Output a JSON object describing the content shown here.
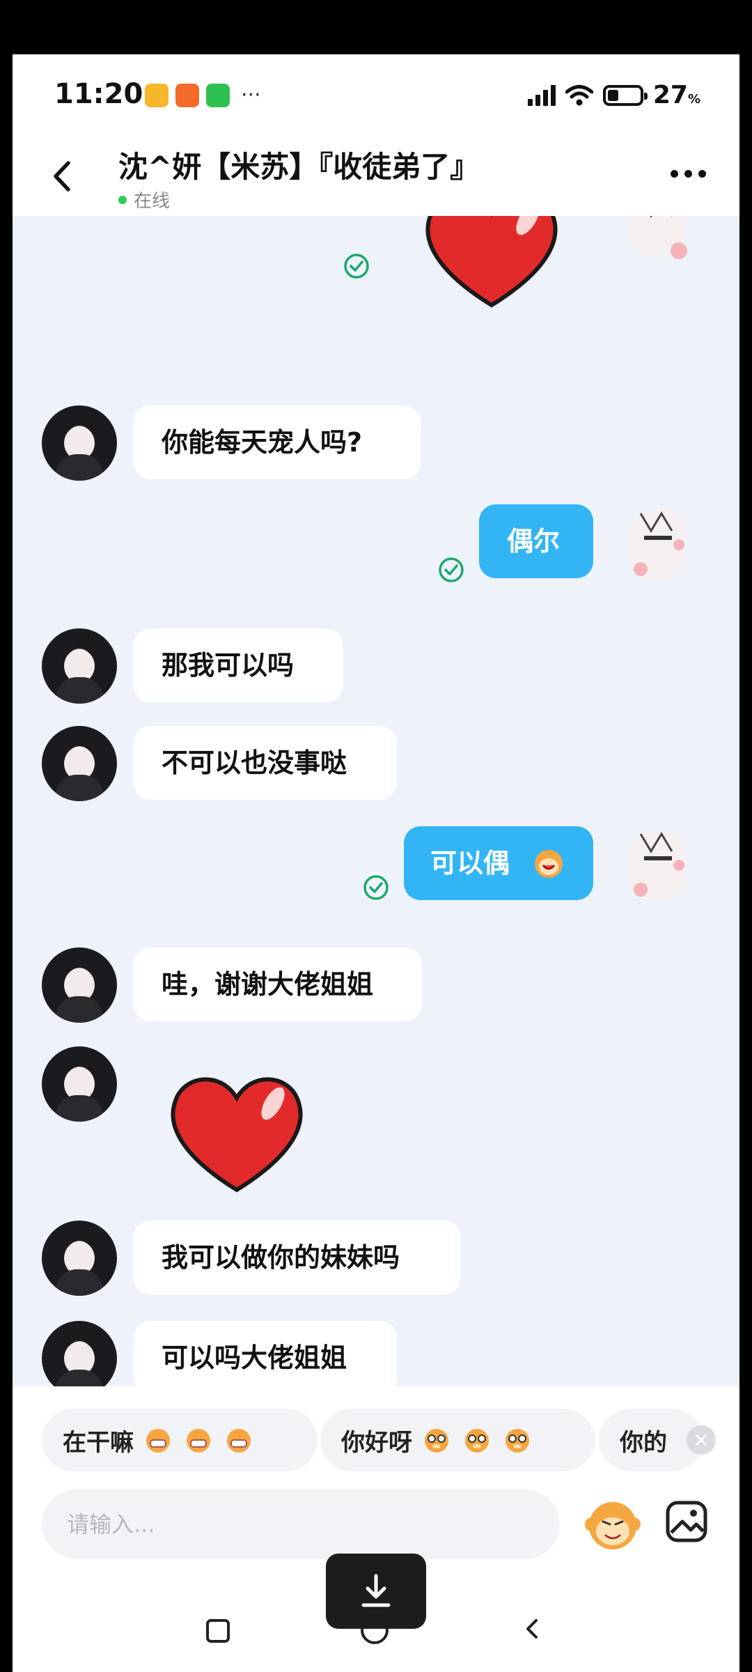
{
  "status_bar": {
    "time": "11:20",
    "more": "···",
    "battery_pct": "27",
    "battery_unit": "%"
  },
  "header": {
    "title": "沈^妍【米苏】『收徒弟了』",
    "status": "在线"
  },
  "messages": {
    "m1": "你能每天宠人吗?",
    "m2": "偶尔",
    "m3": "那我可以吗",
    "m4": "不可以也没事哒",
    "m5": "可以偶",
    "m6": "哇，谢谢大佬姐姐",
    "m7": "我可以做你的妹妹吗",
    "m8": "可以吗大佬姐姐"
  },
  "quick_replies": {
    "r1": "在干嘛",
    "r2": "你好呀",
    "r3": "你的"
  },
  "input": {
    "placeholder": "请输入..."
  },
  "colors": {
    "outgoing_bubble": "#33b5f5",
    "chat_background": "#eef3fb",
    "online": "#2ecc55"
  }
}
